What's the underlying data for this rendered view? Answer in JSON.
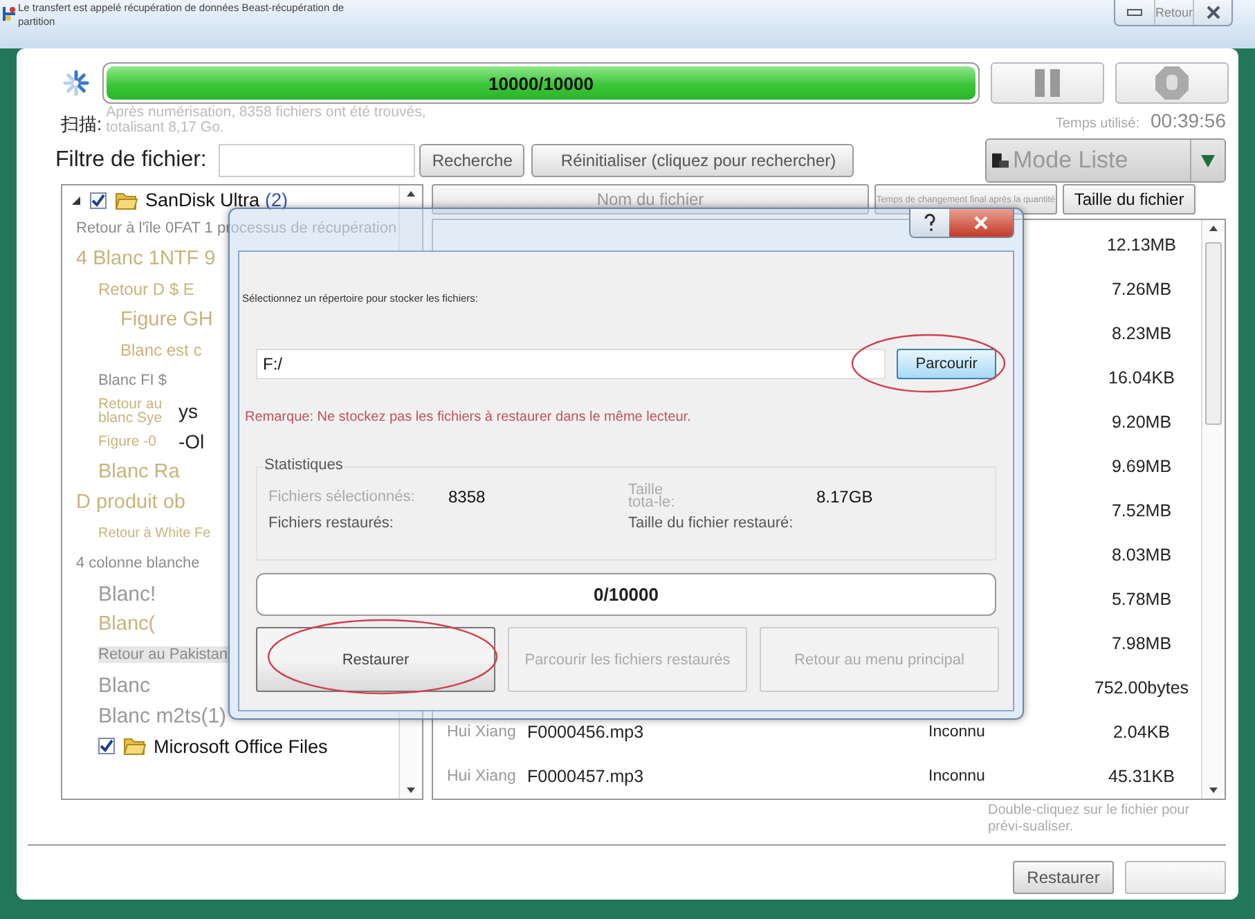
{
  "window": {
    "title": "Le transfert est appelé récupération de données Beast-récupération de partition",
    "controls": [
      {
        "kind": "minimize"
      },
      {
        "kind": "maximize",
        "label": "Retour"
      },
      {
        "kind": "close"
      }
    ]
  },
  "scan": {
    "progress": {
      "text": "10000/10000",
      "level": 1
    },
    "controls": [
      {
        "kind": "pause"
      },
      {
        "kind": "stop"
      }
    ],
    "label": "扫描:",
    "summary": "Après numérisation, 8358 fichiers ont été trouvés, totalisant 8,17 Go.",
    "time_label": "Temps utilisé:",
    "time": "00:39:56"
  },
  "filter": {
    "label": "Filtre de fichier:",
    "search_button": "Recherche",
    "reset_button": "Réinitialiser (cliquez pour rechercher)",
    "view_mode": "Mode Liste"
  },
  "tree": {
    "root": {
      "label": "SanDisk Ultra",
      "count": "(2)",
      "checked": true,
      "expanded": true,
      "children": [
        {
          "kind": "note",
          "label": "Retour à l'île 0FAT 1 processus de récupération",
          "selected": false
        },
        {
          "kind": "group",
          "label": "4 Blanc 1NTF 9",
          "selected": false,
          "children": [
            {
              "kind": "sub",
              "label": "Retour D $ E",
              "selected": false,
              "children": [
                {
                  "kind": "group",
                  "label": "Figure GH",
                  "selected": false
                },
                {
                  "kind": "sub",
                  "label": "Blanc est c",
                  "selected": false
                }
              ]
            },
            {
              "kind": "note",
              "label": "Blanc FI $",
              "selected": false
            },
            {
              "kind": "small",
              "label": "Retour au blanc Sye",
              "aside": "ys",
              "selected": false
            },
            {
              "kind": "small",
              "label": "Figure -0",
              "aside": "-Ol",
              "selected": false
            },
            {
              "kind": "group",
              "label": "Blanc Ra",
              "selected": false
            }
          ]
        },
        {
          "kind": "group",
          "label": "D produit ob",
          "selected": false,
          "children": [
            {
              "kind": "fine",
              "label": "Retour à White Fe",
              "selected": false
            }
          ]
        },
        {
          "kind": "note",
          "label": "4 colonne blanche",
          "selected": false,
          "children": [
            {
              "kind": "item",
              "label": "Blanc!",
              "selected": false
            },
            {
              "kind": "group",
              "label": "Blanc(",
              "selected": false
            },
            {
              "kind": "note",
              "label": "Retour au Pakistan",
              "selected": true
            },
            {
              "kind": "item",
              "label": "Blanc",
              "selected": false
            },
            {
              "kind": "item",
              "label": "Blanc m2ts(1)",
              "selected": false
            },
            {
              "kind": "folder",
              "label": "Microsoft Office Files",
              "checked": true,
              "selected": false
            }
          ]
        }
      ]
    }
  },
  "file_list": {
    "columns": [
      {
        "label": "Nom du fichier"
      },
      {
        "label": "Temps de changement final après la quantité"
      },
      {
        "label": "Taille du fichier"
      }
    ],
    "rows": [
      {
        "size": "12.13MB"
      },
      {
        "size": "7.26MB"
      },
      {
        "size": "8.23MB"
      },
      {
        "size": "16.04KB"
      },
      {
        "size": "9.20MB"
      },
      {
        "size": "9.69MB"
      },
      {
        "size": "7.52MB"
      },
      {
        "size": "8.03MB"
      },
      {
        "size": "5.78MB"
      },
      {
        "size": "7.98MB"
      },
      {
        "size": "752.00bytes"
      },
      {
        "source": "Hui Xiang",
        "name": "F0000456.mp3",
        "type": "Inconnu",
        "size": "2.04KB"
      },
      {
        "source": "Hui Xiang",
        "name": "F0000457.mp3",
        "type": "Inconnu",
        "size": "45.31KB"
      }
    ],
    "hint": "Double-cliquez sur le fichier pour prévi-sualiser."
  },
  "footer_buttons": [
    {
      "label": "Restaurer",
      "disabled": false
    },
    {
      "disabled": true
    }
  ],
  "dialog": {
    "instruction": "Sélectionnez un répertoire pour stocker les fichiers:",
    "path": "F:/",
    "browse_button": {
      "label": "Parcourir",
      "highlighted": true
    },
    "remark": "Remarque: Ne stockez pas les fichiers à restaurer dans le même lecteur.",
    "stats": {
      "title": "Statistiques",
      "fields": [
        {
          "label": "Fichiers sélectionnés:",
          "value": "8358",
          "dimmed": true
        },
        {
          "label": "Taille tota-le:",
          "value": "8.17GB",
          "dimmed": true
        },
        {
          "label": "Fichiers restaurés:",
          "dimmed": false
        },
        {
          "label": "Taille du fichier restauré:",
          "dimmed": false
        }
      ]
    },
    "progress": {
      "text": "0/10000",
      "level": 0
    },
    "buttons": [
      {
        "label": "Restaurer",
        "disabled": false,
        "highlighted": true
      },
      {
        "label": "Parcourir les fichiers restaurés",
        "disabled": true,
        "highlighted": false
      },
      {
        "label": "Retour au menu principal",
        "disabled": true,
        "highlighted": false
      }
    ]
  }
}
